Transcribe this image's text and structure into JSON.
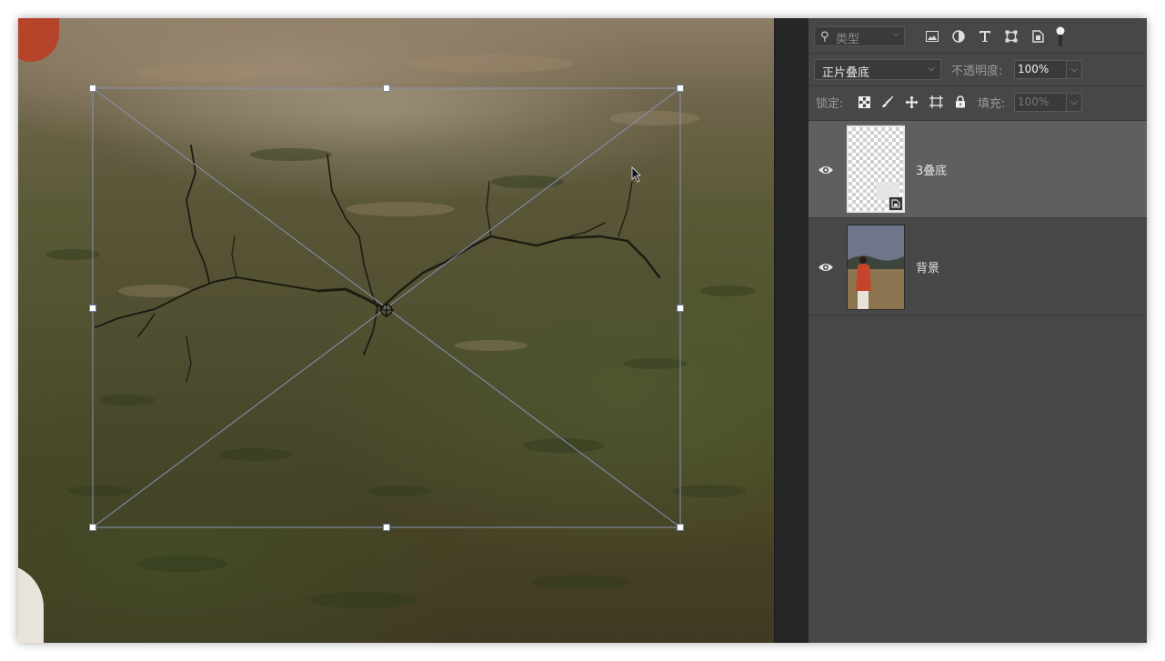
{
  "toolbar": {
    "filter_icon": "search-icon",
    "filter_placeholder": "类型",
    "filter_icons": [
      "image-filter-icon",
      "adjustment-filter-icon",
      "type-filter-icon",
      "shape-filter-icon",
      "smart-object-filter-icon",
      "filter-toggle-icon"
    ]
  },
  "blend": {
    "mode": "正片叠底",
    "opacity_label": "不透明度:",
    "opacity_value": "100%"
  },
  "lock": {
    "label": "锁定:",
    "icons": [
      "lock-transparent-pixels-icon",
      "lock-image-pixels-icon",
      "lock-position-icon",
      "lock-artboard-icon",
      "lock-all-icon"
    ],
    "fill_label": "填充:",
    "fill_value": "100%"
  },
  "layers": [
    {
      "name": "3叠底",
      "selected": true,
      "visible": true,
      "thumbnail": "transparent",
      "smart_object": true
    },
    {
      "name": "背景",
      "selected": false,
      "visible": true,
      "thumbnail": "photo",
      "smart_object": false
    }
  ],
  "colors": {
    "panel_bg": "#474747",
    "selected_layer_bg": "#5f5f5f",
    "transform_handle_border": "#6d7ea8"
  }
}
